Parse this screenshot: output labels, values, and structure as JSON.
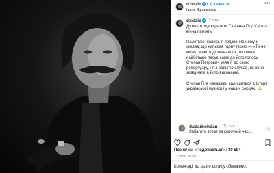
{
  "header": {
    "username": "dzidzio",
    "follow_label": "Стежити",
    "location": "Івано-Франківськ"
  },
  "caption": {
    "username": "dzidzio",
    "time": "12 тиж.",
    "paragraphs": [
      "Дуже шкода втратити Степана Гігу. Світла і вічна пам'ять.",
      "Пам'ятаю, колись я подзвонив йому й сказав, що написав гарну пісню — «Ти не моя». Мені тоді здавалося, що вона найбільше пасує саме до його голосу. Степан Петрович узяв її до свого репертуару, і я з радістю слухав, як вона зазвучала в його виконанні.",
      "Степан Гіга назавжди залишиться в історії української музики і у наших серцях. 🙏"
    ]
  },
  "comment": {
    "username": "dudarbohdan",
    "time": "12 тиж.",
    "text": "Забагато втрат за короткий час..."
  },
  "actions": {
    "likes_label": "Позначки «Подобається»: 30 594",
    "date": "12 тиж. тому",
    "comment_placeholder": "Коментарі до цього допису обмежено."
  },
  "icons": [
    "heart-icon",
    "comment-icon",
    "share-icon",
    "bookmark-icon",
    "more-icon"
  ],
  "colors": {
    "accent": "#0095f6",
    "text": "#262626",
    "muted": "#8e8e8e"
  }
}
